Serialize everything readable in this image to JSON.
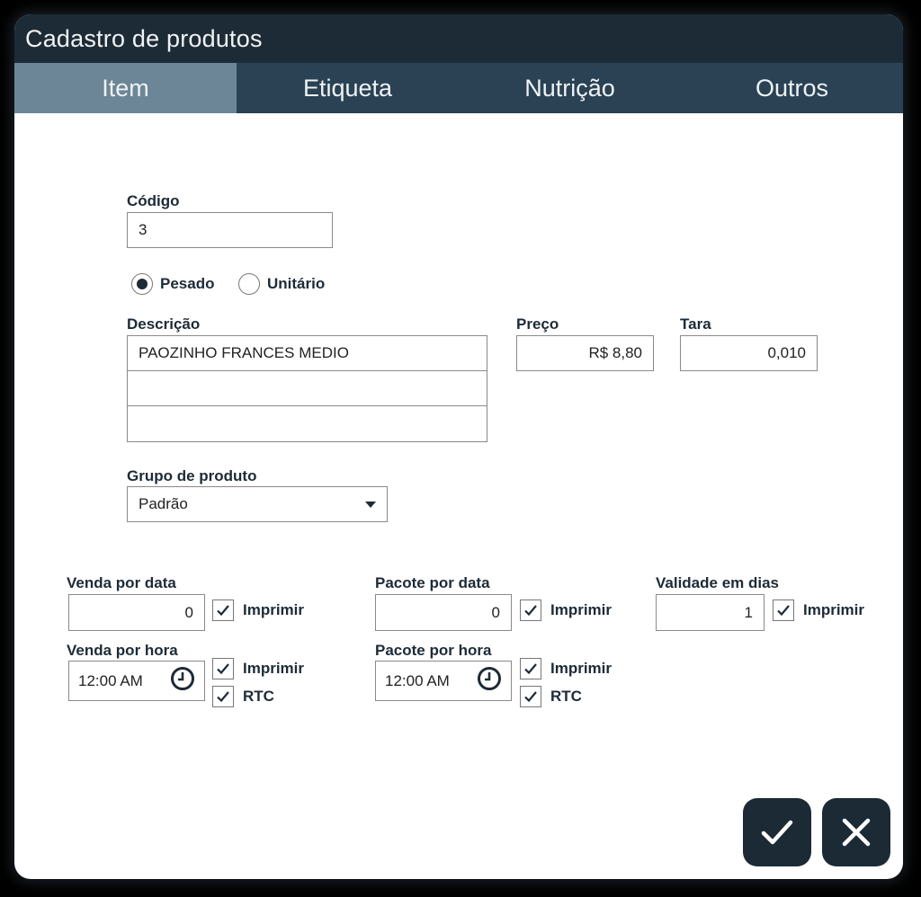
{
  "window": {
    "title": "Cadastro de produtos"
  },
  "tabs": [
    {
      "label": "Item",
      "active": true
    },
    {
      "label": "Etiqueta",
      "active": false
    },
    {
      "label": "Nutrição",
      "active": false
    },
    {
      "label": "Outros",
      "active": false
    }
  ],
  "form": {
    "codigo": {
      "label": "Código",
      "value": "3"
    },
    "tipo": {
      "options": [
        {
          "label": "Pesado",
          "selected": true
        },
        {
          "label": "Unitário",
          "selected": false
        }
      ]
    },
    "descricao": {
      "label": "Descrição",
      "lines": [
        "PAOZINHO FRANCES MEDIO",
        "",
        ""
      ]
    },
    "preco": {
      "label": "Preço",
      "value": "R$ 8,80"
    },
    "tara": {
      "label": "Tara",
      "value": "0,010"
    },
    "grupo": {
      "label": "Grupo de produto",
      "selected": "Padrão"
    },
    "venda_por_data": {
      "label": "Venda por data",
      "value": "0",
      "imprimir_label": "Imprimir",
      "imprimir": true
    },
    "pacote_por_data": {
      "label": "Pacote por data",
      "value": "0",
      "imprimir_label": "Imprimir",
      "imprimir": true
    },
    "validade_em_dias": {
      "label": "Validade em dias",
      "value": "1",
      "imprimir_label": "Imprimir",
      "imprimir": true
    },
    "venda_por_hora": {
      "label": "Venda por hora",
      "value": "12:00 AM",
      "imprimir_label": "Imprimir",
      "imprimir": true,
      "rtc_label": "RTC",
      "rtc": true
    },
    "pacote_por_hora": {
      "label": "Pacote por hora",
      "value": "12:00 AM",
      "imprimir_label": "Imprimir",
      "imprimir": true,
      "rtc_label": "RTC",
      "rtc": true
    }
  },
  "actions": {
    "confirm_icon": "check-icon",
    "cancel_icon": "close-icon"
  },
  "colors": {
    "titlebar": "#1d2b37",
    "tabbar": "#2a4254",
    "tab_active": "#6c8698",
    "button": "#1c2a36"
  }
}
